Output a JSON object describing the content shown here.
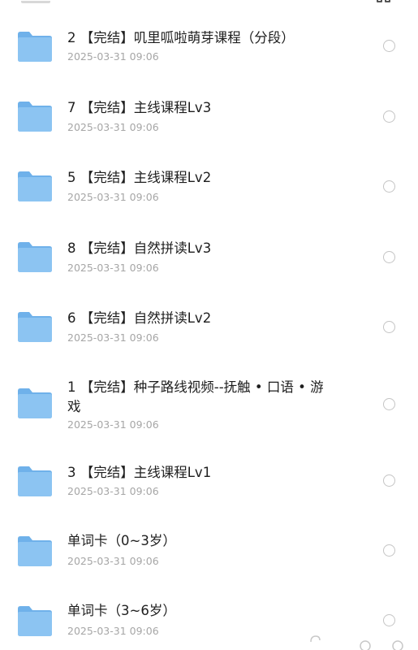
{
  "colors": {
    "folder_main": "#8cc4f2",
    "folder_tab": "#6fb1ea",
    "title": "#1e1e1e",
    "date": "#a6a6a6",
    "radio": "#c4c4c4"
  },
  "header": {
    "grid_icon": "grid-view-icon"
  },
  "files": [
    {
      "title": "2 【完结】叽里呱啦萌芽课程（分段）",
      "date": "2025-03-31 09:06"
    },
    {
      "title": "7 【完结】主线课程Lv3",
      "date": "2025-03-31 09:06"
    },
    {
      "title": "5 【完结】主线课程Lv2",
      "date": "2025-03-31 09:06"
    },
    {
      "title": "8 【完结】自然拼读Lv3",
      "date": "2025-03-31 09:06"
    },
    {
      "title": "6 【完结】自然拼读Lv2",
      "date": "2025-03-31 09:06"
    },
    {
      "title": "1 【完结】种子路线视频--抚触 • 口语 • 游戏",
      "date": "2025-03-31 09:06"
    },
    {
      "title": "3 【完结】主线课程Lv1",
      "date": "2025-03-31 09:06"
    },
    {
      "title": "单词卡（0~3岁）",
      "date": "2025-03-31 09:06"
    },
    {
      "title": "单词卡（3~6岁）",
      "date": "2025-03-31 09:06"
    }
  ]
}
